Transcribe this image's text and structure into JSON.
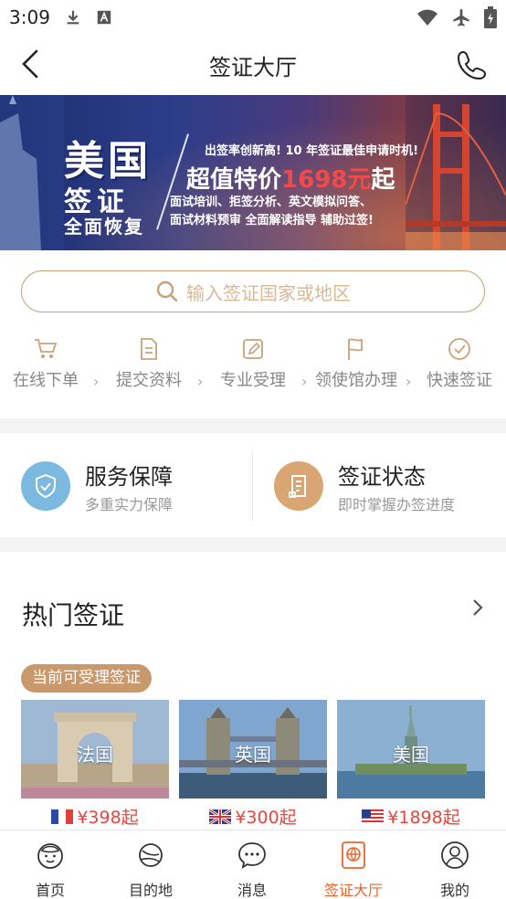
{
  "status": {
    "time": "3:09"
  },
  "nav": {
    "title": "签证大厅"
  },
  "banner": {
    "big1": "美国",
    "big2": "签证",
    "big3": "全面恢复",
    "sub": "出签率创新高! 10 年签证最佳申请时机!",
    "price_prefix": "超值特价",
    "price_value": "1698元",
    "price_suffix": "起",
    "desc1": "面试培训、拒签分析、英文模拟问答、",
    "desc2": "面试材料预审 全面解读指导 辅助过签!"
  },
  "search": {
    "placeholder": "输入签证国家或地区"
  },
  "steps": [
    "在线下单",
    "提交资料",
    "专业受理",
    "领使馆办理",
    "快速签证"
  ],
  "services": [
    {
      "title": "服务保障",
      "subtitle": "多重实力保障",
      "icon": "shield-icon",
      "color": "#7cb9e0"
    },
    {
      "title": "签证状态",
      "subtitle": "即时掌握办签进度",
      "icon": "document-icon",
      "color": "#d9a572"
    }
  ],
  "hot": {
    "title": "热门签证",
    "tag": "当前可受理签证",
    "cards": [
      {
        "name": "法国",
        "price": "¥398起"
      },
      {
        "name": "英国",
        "price": "¥300起"
      },
      {
        "name": "美国",
        "price": "¥1898起"
      }
    ]
  },
  "tabs": [
    "首页",
    "目的地",
    "消息",
    "签证大厅",
    "我的"
  ],
  "colors": {
    "accent": "#e8652c",
    "gold": "#c9996b",
    "price": "#e8453c"
  }
}
